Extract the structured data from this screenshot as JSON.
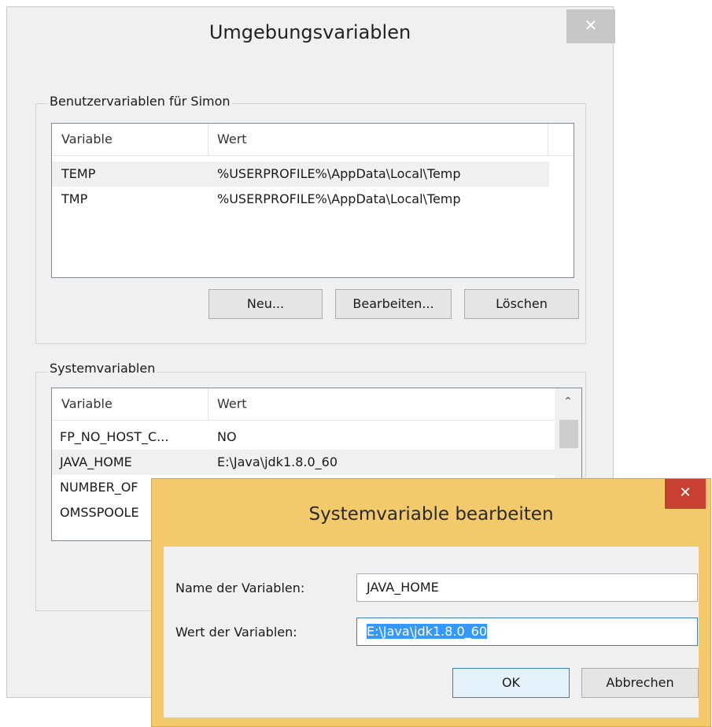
{
  "main_dialog": {
    "title": "Umgebungsvariablen",
    "close_glyph": "✕",
    "user_group": {
      "label": "Benutzervariablen für Simon",
      "columns": [
        "Variable",
        "Wert"
      ],
      "rows": [
        {
          "variable": "TEMP",
          "value": "%USERPROFILE%\\AppData\\Local\\Temp"
        },
        {
          "variable": "TMP",
          "value": "%USERPROFILE%\\AppData\\Local\\Temp"
        }
      ],
      "buttons": {
        "new": "Neu...",
        "edit": "Bearbeiten...",
        "delete": "Löschen"
      }
    },
    "system_group": {
      "label": "Systemvariablen",
      "columns": [
        "Variable",
        "Wert"
      ],
      "rows": [
        {
          "variable": "FP_NO_HOST_C...",
          "value": "NO"
        },
        {
          "variable": "JAVA_HOME",
          "value": "E:\\Java\\jdk1.8.0_60"
        },
        {
          "variable": "NUMBER_OF",
          "value": ""
        },
        {
          "variable": "OMSSPOOLE",
          "value": ""
        }
      ],
      "scroll_up_glyph": "⌃"
    }
  },
  "edit_dialog": {
    "title": "Systemvariable bearbeiten",
    "close_glyph": "✕",
    "name_label": "Name der Variablen:",
    "name_value": "JAVA_HOME",
    "value_label": "Wert der Variablen:",
    "value_value": "E:\\Java\\jdk1.8.0_60",
    "ok_label": "OK",
    "cancel_label": "Abbrechen",
    "accent_color": "#f2c96b",
    "close_color": "#c84031",
    "selection_color": "#3399ff"
  }
}
